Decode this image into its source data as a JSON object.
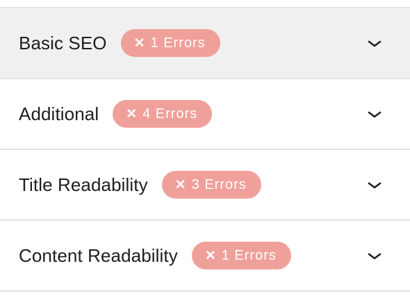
{
  "panels": [
    {
      "title": "Basic SEO",
      "badge_text": "1 Errors",
      "badge_icon": "x-icon",
      "toggle_icon": "chevron-down-icon",
      "active": true
    },
    {
      "title": "Additional",
      "badge_text": "4 Errors",
      "badge_icon": "x-icon",
      "toggle_icon": "chevron-down-icon",
      "active": false
    },
    {
      "title": "Title Readability",
      "badge_text": "3 Errors",
      "badge_icon": "x-icon",
      "toggle_icon": "chevron-down-icon",
      "active": false
    },
    {
      "title": "Content Readability",
      "badge_text": "1 Errors",
      "badge_icon": "x-icon",
      "toggle_icon": "chevron-down-icon",
      "active": false
    }
  ],
  "colors": {
    "badge_background": "#f0a09a",
    "badge_text": "#ffffff",
    "active_panel_background": "#f0f0f0",
    "divider": "#e2e2e2",
    "title_text": "#1e1e1e"
  }
}
